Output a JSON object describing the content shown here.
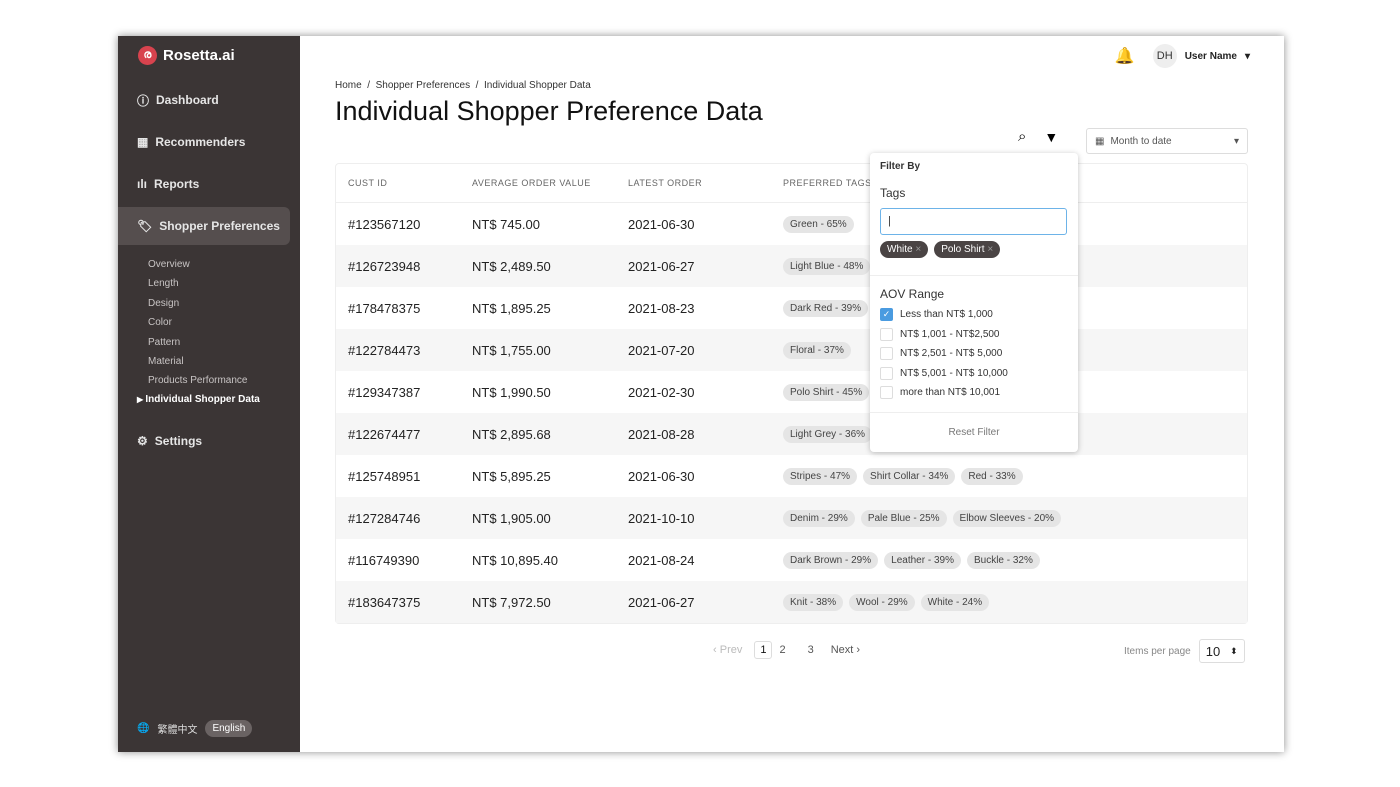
{
  "brand": "Rosetta.ai",
  "sidebar": {
    "items": [
      {
        "label": "Dashboard",
        "icon": "dashboard-icon"
      },
      {
        "label": "Recommenders",
        "icon": "grid-icon"
      },
      {
        "label": "Reports",
        "icon": "bar-chart-icon"
      },
      {
        "label": "Shopper Preferences",
        "icon": "tag-icon"
      },
      {
        "label": "Settings",
        "icon": "gear-icon"
      }
    ],
    "subitems": [
      "Overview",
      "Length",
      "Design",
      "Color",
      "Pattern",
      "Material",
      "Products Performance",
      "Individual Shopper Data"
    ],
    "lang": {
      "zh": "繁體中文",
      "en": "English"
    }
  },
  "header": {
    "user_initials": "DH",
    "user_name": "User Name"
  },
  "breadcrumb": [
    "Home",
    "Shopper Preferences",
    "Individual Shopper Data"
  ],
  "title": "Individual Shopper Preference Data",
  "date_range": "Month to date",
  "table": {
    "headers": [
      "CUST ID",
      "AVERAGE ORDER VALUE",
      "LATEST ORDER",
      "PREFERRED TAGS"
    ],
    "rows": [
      {
        "id": "#123567120",
        "aov": "NT$ 745.00",
        "date": "2021-06-30",
        "tags": [
          "Green - 65%"
        ]
      },
      {
        "id": "#126723948",
        "aov": "NT$ 2,489.50",
        "date": "2021-06-27",
        "tags": [
          "Light Blue - 48%"
        ]
      },
      {
        "id": "#178478375",
        "aov": "NT$ 1,895.25",
        "date": "2021-08-23",
        "tags": [
          "Dark Red - 39%"
        ]
      },
      {
        "id": "#122784473",
        "aov": "NT$ 1,755.00",
        "date": "2021-07-20",
        "tags": [
          "Floral - 37%"
        ]
      },
      {
        "id": "#129347387",
        "aov": "NT$ 1,990.50",
        "date": "2021-02-30",
        "tags": [
          "Polo Shirt - 45%"
        ]
      },
      {
        "id": "#122674477",
        "aov": "NT$ 2,895.68",
        "date": "2021-08-28",
        "tags": [
          "Light Grey - 36%"
        ]
      },
      {
        "id": "#125748951",
        "aov": "NT$ 5,895.25",
        "date": "2021-06-30",
        "tags": [
          "Stripes - 47%",
          "Shirt Collar - 34%",
          "Red - 33%"
        ]
      },
      {
        "id": "#127284746",
        "aov": "NT$ 1,905.00",
        "date": "2021-10-10",
        "tags": [
          "Denim - 29%",
          "Pale Blue - 25%",
          "Elbow Sleeves - 20%"
        ]
      },
      {
        "id": "#116749390",
        "aov": "NT$ 10,895.40",
        "date": "2021-08-24",
        "tags": [
          "Dark Brown - 29%",
          "Leather - 39%",
          "Buckle - 32%"
        ]
      },
      {
        "id": "#183647375",
        "aov": "NT$ 7,972.50",
        "date": "2021-06-27",
        "tags": [
          "Knit - 38%",
          "Wool - 29%",
          "White - 24%"
        ]
      }
    ]
  },
  "pagination": {
    "prev": "Prev",
    "pages": [
      "1",
      "2",
      "3"
    ],
    "current": "1",
    "next": "Next",
    "items_label": "Items per page",
    "items_value": "10"
  },
  "filter": {
    "title": "Filter By",
    "tags_label": "Tags",
    "tags_input": "|",
    "chips": [
      "White",
      "Polo Shirt"
    ],
    "aov_label": "AOV Range",
    "options": [
      {
        "label": "Less than NT$ 1,000",
        "checked": true
      },
      {
        "label": "NT$ 1,001 - NT$2,500",
        "checked": false
      },
      {
        "label": "NT$ 2,501 - NT$ 5,000",
        "checked": false
      },
      {
        "label": "NT$ 5,001 - NT$ 10,000",
        "checked": false
      },
      {
        "label": "more than NT$ 10,001",
        "checked": false
      }
    ],
    "reset": "Reset Filter"
  },
  "colors": {
    "sidebar": "#3b3535",
    "accent": "#4a9be0",
    "logo": "#d8434e"
  }
}
